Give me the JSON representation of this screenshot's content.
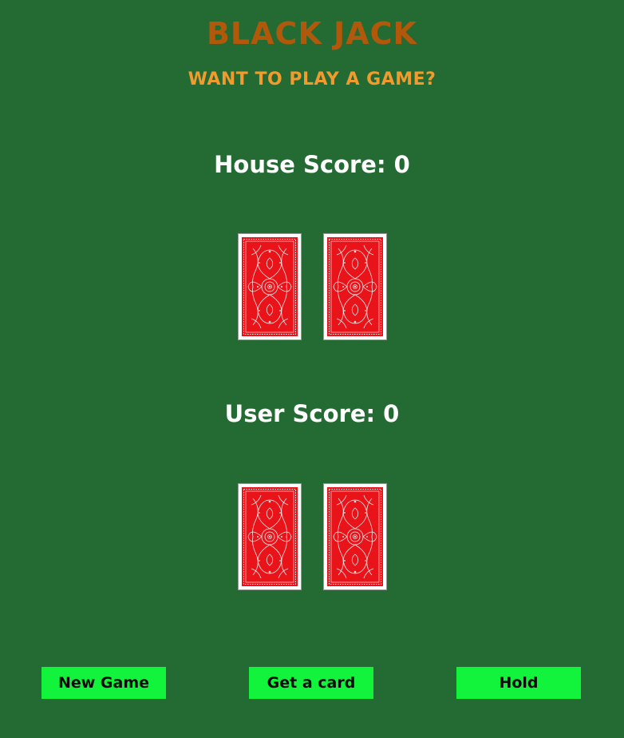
{
  "header": {
    "title": "BLACK JACK",
    "subtitle": "WANT TO PLAY A GAME?"
  },
  "house": {
    "score_label": "House Score: 0",
    "cards": [
      {
        "face": "back"
      },
      {
        "face": "back"
      }
    ]
  },
  "user": {
    "score_label": "User Score: 0",
    "cards": [
      {
        "face": "back"
      },
      {
        "face": "back"
      }
    ]
  },
  "controls": {
    "new_game_label": "New Game",
    "get_card_label": "Get a card",
    "hold_label": "Hold"
  },
  "colors": {
    "table": "#246b33",
    "title": "#b1580b",
    "subtitle": "#f19a2e",
    "card_back": "#e8141a",
    "button": "#12f43c"
  }
}
